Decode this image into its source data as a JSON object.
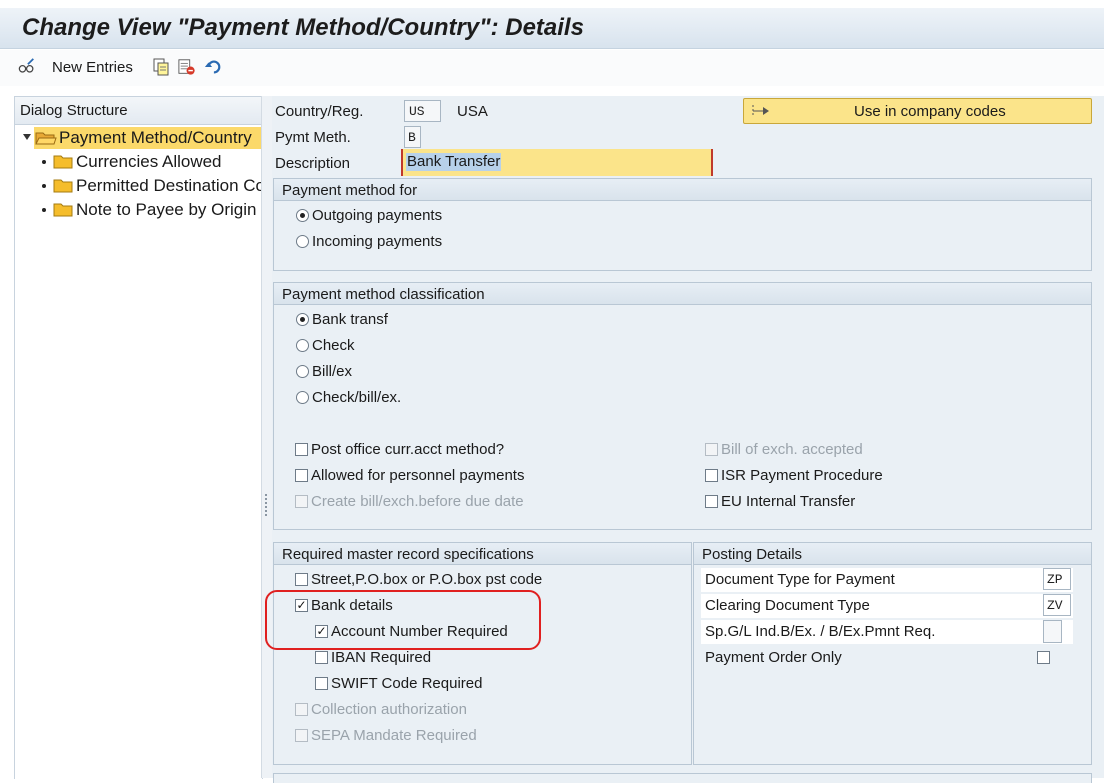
{
  "window": {
    "title": "Change View \"Payment Method/Country\": Details"
  },
  "toolbar": {
    "new_entries_label": "New Entries",
    "icons": [
      "glasses-pencil-icon",
      "copy-icon",
      "delete-icon",
      "undo-icon"
    ]
  },
  "dialog_structure": {
    "header": "Dialog Structure",
    "root": "Payment Method/Country",
    "children": [
      "Currencies Allowed",
      "Permitted Destination Countries",
      "Note to Payee by Origin"
    ]
  },
  "header_fields": {
    "country_label": "Country/Reg.",
    "country_value": "US",
    "country_name": "USA",
    "pymt_meth_label": "Pymt Meth.",
    "pymt_meth_value": "B",
    "description_label": "Description",
    "description_value": "Bank Transfer",
    "use_in_cc_label": "Use in company codes"
  },
  "payment_method_for": {
    "title": "Payment method for",
    "options": [
      "Outgoing payments",
      "Incoming payments"
    ],
    "selected": "Outgoing payments"
  },
  "classification": {
    "title": "Payment method classification",
    "options": [
      "Bank transf",
      "Check",
      "Bill/ex",
      "Check/bill/ex."
    ],
    "selected": "Bank transf",
    "left_checks": [
      {
        "label": "Post office curr.acct method?",
        "checked": false,
        "enabled": true
      },
      {
        "label": "Allowed for personnel payments",
        "checked": false,
        "enabled": true
      },
      {
        "label": "Create bill/exch.before due date",
        "checked": false,
        "enabled": false
      }
    ],
    "right_checks": [
      {
        "label": "Bill of exch. accepted",
        "checked": false,
        "enabled": false
      },
      {
        "label": "ISR Payment Procedure",
        "checked": false,
        "enabled": true
      },
      {
        "label": "EU Internal Transfer",
        "checked": false,
        "enabled": true
      }
    ]
  },
  "master_record": {
    "title": "Required master record specifications",
    "checks": [
      {
        "label": "Street,P.O.box or P.O.box pst code",
        "checked": false,
        "enabled": true
      },
      {
        "label": "Bank details",
        "checked": true,
        "enabled": true
      },
      {
        "label": "Account Number Required",
        "checked": true,
        "enabled": true
      },
      {
        "label": "IBAN Required",
        "checked": false,
        "enabled": true
      },
      {
        "label": "SWIFT Code Required",
        "checked": false,
        "enabled": true
      },
      {
        "label": "Collection authorization",
        "checked": false,
        "enabled": false
      },
      {
        "label": "SEPA Mandate Required",
        "checked": false,
        "enabled": false
      }
    ],
    "check_mark": "✓"
  },
  "posting_details": {
    "title": "Posting Details",
    "doc_type_label": "Document Type for Payment",
    "doc_type_value": "ZP",
    "clearing_label": "Clearing Document Type",
    "clearing_value": "ZV",
    "spgl_label": "Sp.G/L Ind.B/Ex. / B/Ex.Pmnt Req.",
    "spgl_value": "",
    "order_only_label": "Payment Order Only",
    "order_only_checked": false
  },
  "colors": {
    "highlight": "#e02020",
    "tree_selected": "#fbd96a",
    "button_yellow": "#fbe48a"
  }
}
